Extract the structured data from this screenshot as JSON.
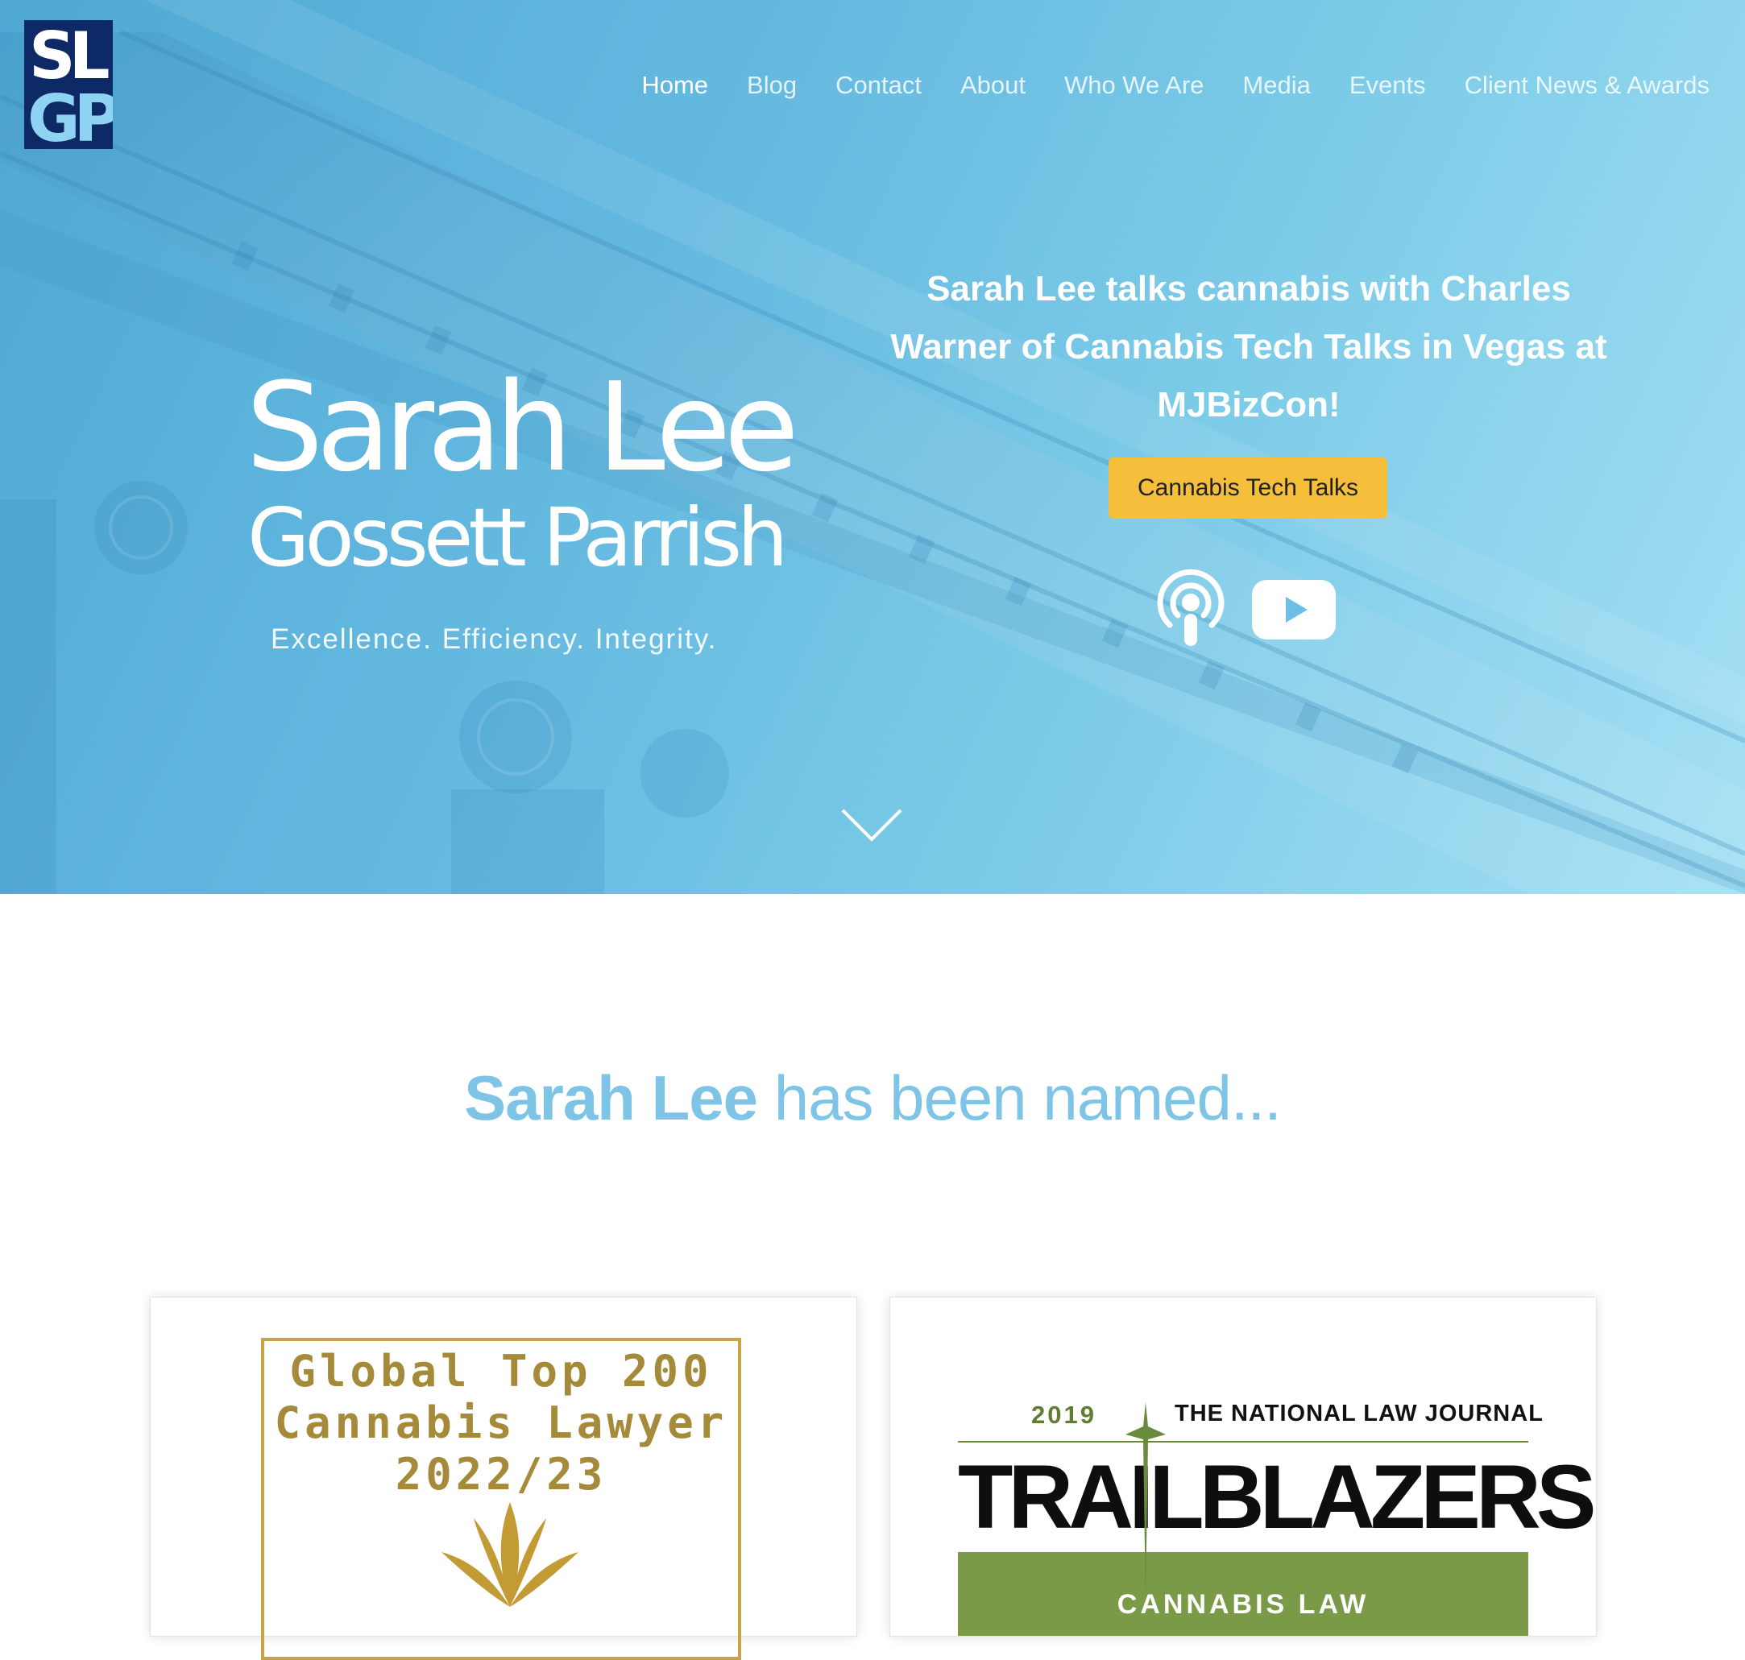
{
  "colors": {
    "hero_start": "#4fa9d4",
    "hero_end": "#a6e0f4",
    "cta_bg": "#f5bf3c",
    "heading_blue": "#7ec4e6",
    "logo_navy": "#0d2a66",
    "logo_light": "#8fd3f2",
    "award_gold": "#a58a3a",
    "trailblazer_green": "#7b9a47"
  },
  "logo": {
    "text_top": "SL",
    "text_bottom": "GP"
  },
  "nav": {
    "items": [
      {
        "label": "Home",
        "active": true
      },
      {
        "label": "Blog"
      },
      {
        "label": "Contact"
      },
      {
        "label": "About"
      },
      {
        "label": "Who We Are"
      },
      {
        "label": "Media"
      },
      {
        "label": "Events"
      },
      {
        "label": "Client News & Awards"
      }
    ]
  },
  "hero": {
    "name": "Sarah Lee",
    "firm": "Gossett Parrish",
    "tagline": "Excellence. Efficiency. Integrity.",
    "headline": "Sarah Lee talks cannabis with Charles Warner of Cannabis Tech Talks in Vegas at MJBizCon!",
    "cta_label": "Cannabis Tech Talks",
    "icons": [
      "podcast-icon",
      "youtube-icon",
      "chevron-down-icon"
    ]
  },
  "named": {
    "strong": "Sarah Lee",
    "rest": " has been named..."
  },
  "cards": {
    "award": {
      "line1": "Global Top 200",
      "line2": "Cannabis Lawyer",
      "line3": "2022/23"
    },
    "trailblazers": {
      "year": "2019",
      "journal": "THE NATIONAL LAW JOURNAL",
      "title": "TRAILBLAZERS",
      "subtitle": "CANNABIS LAW"
    }
  }
}
